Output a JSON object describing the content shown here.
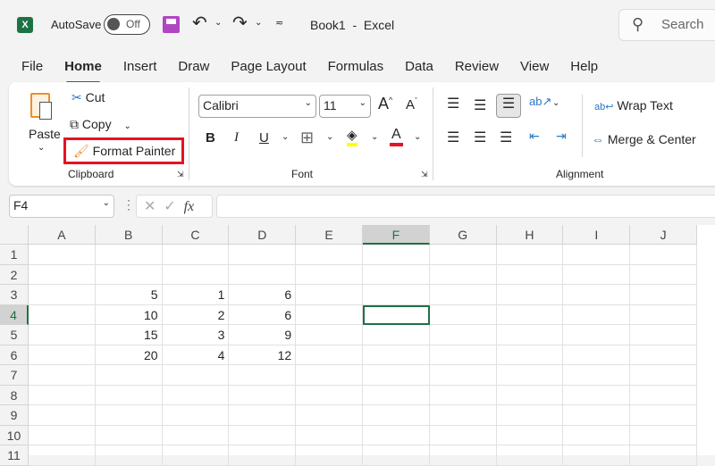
{
  "titlebar": {
    "autosave_label": "AutoSave",
    "toggle_state": "Off",
    "doc_title": "Book1  -  Excel",
    "search_placeholder": "Search"
  },
  "tabs": [
    "File",
    "Home",
    "Insert",
    "Draw",
    "Page Layout",
    "Formulas",
    "Data",
    "Review",
    "View",
    "Help"
  ],
  "ribbon": {
    "paste": "Paste",
    "cut": "Cut",
    "copy": "Copy",
    "format_painter": "Format Painter",
    "clipboard_group": "Clipboard",
    "font_name": "Calibri",
    "font_size": "11",
    "bold": "B",
    "italic": "I",
    "underline": "U",
    "font_group": "Font",
    "wrap_text": "Wrap Text",
    "merge_center": "Merge & Center",
    "alignment_group": "Alignment",
    "highlight_color": "#e81123"
  },
  "formula_bar": {
    "name_box": "F4",
    "fx": "fx",
    "value": ""
  },
  "grid": {
    "columns": [
      "A",
      "B",
      "C",
      "D",
      "E",
      "F",
      "G",
      "H",
      "I",
      "J"
    ],
    "rows": [
      "1",
      "2",
      "3",
      "4",
      "5",
      "6",
      "7",
      "8",
      "9",
      "10",
      "11"
    ],
    "cells": [
      {
        "ref": "B3",
        "col": 1,
        "row": 2,
        "v": "5"
      },
      {
        "ref": "C3",
        "col": 2,
        "row": 2,
        "v": "1"
      },
      {
        "ref": "D3",
        "col": 3,
        "row": 2,
        "v": "6"
      },
      {
        "ref": "B4",
        "col": 1,
        "row": 3,
        "v": "10"
      },
      {
        "ref": "C4",
        "col": 2,
        "row": 3,
        "v": "2"
      },
      {
        "ref": "D4",
        "col": 3,
        "row": 3,
        "v": "6"
      },
      {
        "ref": "B5",
        "col": 1,
        "row": 4,
        "v": "15"
      },
      {
        "ref": "C5",
        "col": 2,
        "row": 4,
        "v": "3"
      },
      {
        "ref": "D5",
        "col": 3,
        "row": 4,
        "v": "9"
      },
      {
        "ref": "B6",
        "col": 1,
        "row": 5,
        "v": "20"
      },
      {
        "ref": "C6",
        "col": 2,
        "row": 5,
        "v": "4"
      },
      {
        "ref": "D6",
        "col": 3,
        "row": 5,
        "v": "12"
      }
    ],
    "selected": "F4"
  }
}
